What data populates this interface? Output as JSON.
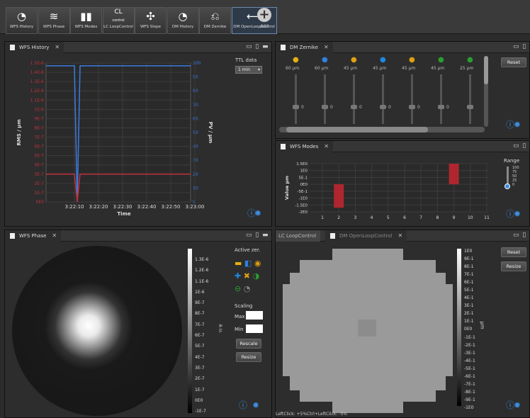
{
  "toolbar": {
    "items": [
      {
        "label": "WFS History",
        "icon": "clock-icon"
      },
      {
        "label": "WFS Phase",
        "icon": "wave-icon"
      },
      {
        "label": "WFS Modes",
        "icon": "bars-icon"
      },
      {
        "label": "LC LoopControl",
        "icon": "cl-icon",
        "title": "CL",
        "sub": "control"
      },
      {
        "label": "WFS Slope",
        "icon": "arrows-icon"
      },
      {
        "label": "DM History",
        "icon": "clock-icon"
      },
      {
        "label": "DM Zernike",
        "icon": "reset-icon"
      },
      {
        "label": "DM OpenLoopControl",
        "icon": "openloop-icon"
      }
    ],
    "add_label": "Add"
  },
  "history": {
    "tab": "WFS History",
    "ttl_label": "TTL data",
    "ttl_value": "1 min",
    "ylabel_left": "RMS / µm",
    "ylabel_right": "PV / µm",
    "xlabel": "Time",
    "left_ticks": [
      "1.5E-6",
      "1.4E-6",
      "1.3E-6",
      "1.2E-6",
      "1.1E-6",
      "1E-6",
      "9E-7",
      "8E-7",
      "7E-7",
      "6E-7",
      "5E-7",
      "4E-7",
      "3E-7",
      "2E-7",
      "1E-7",
      "0E0"
    ],
    "right_ticks": [
      "100",
      "90",
      "80",
      "70",
      "60",
      "50",
      "40",
      "30",
      "20",
      "10",
      "0"
    ],
    "x_ticks": [
      "3:22:10",
      "3:22:20",
      "3:22:30",
      "3:22:40",
      "3:22:50",
      "3:23:00"
    ]
  },
  "chart_data": {
    "type": "line",
    "x": [
      "3:22:05",
      "3:22:08",
      "3:22:09",
      "3:22:10",
      "3:23:05"
    ],
    "xlabel": "Time",
    "ylabel": "RMS / µm",
    "series": [
      {
        "color": "#3b7be0",
        "values": [
          100,
          100,
          0,
          100,
          100
        ]
      },
      {
        "color": "#c0303a",
        "values": [
          3,
          3,
          0,
          3,
          3
        ]
      }
    ]
  },
  "zernike": {
    "tab": "DM Zernike",
    "reset": "Reset",
    "sliders": [
      {
        "label": "60 µm",
        "value": "0"
      },
      {
        "label": "60 µm",
        "value": "0"
      },
      {
        "label": "45 µm",
        "value": "0"
      },
      {
        "label": "45 µm",
        "value": "0"
      },
      {
        "label": "45 µm",
        "value": "0"
      },
      {
        "label": "45 µm",
        "value": "0"
      },
      {
        "label": "25 µm",
        "value": ""
      }
    ]
  },
  "modes": {
    "tab": "WFS Modes",
    "range_label": "Range",
    "ylabel": "Value µm",
    "y_ticks": [
      "1.5E0",
      "1E0",
      "5E-1",
      "0E0",
      "-5E-1",
      "-1E0",
      "-1.5E0",
      "-2E0"
    ],
    "x_ticks": [
      "1",
      "2",
      "3",
      "4",
      "5",
      "6",
      "7",
      "8",
      "9",
      "10",
      "11"
    ],
    "range_ticks": [
      "100",
      "75",
      "50",
      "25",
      "0"
    ]
  },
  "phase": {
    "tab": "WFS Phase",
    "active_label": "Active zer.",
    "scaling_label": "Scaling",
    "max_label": "Max",
    "min_label": "Min",
    "rescale": "Rescale",
    "resize": "Resize",
    "unit": "a.u.",
    "scale": [
      "1.3E-6",
      "1.2E-6",
      "1.1E-6",
      "1E-6",
      "9E-7",
      "8E-7",
      "7E-7",
      "6E-7",
      "5E-7",
      "4E-7",
      "3E-7",
      "2E-7",
      "1E-7",
      "0E0",
      "-1E-7"
    ]
  },
  "loop": {
    "tab1": "LC LoopControl",
    "tab2": "DM OpenLoopControl",
    "reset": "Reset",
    "resize": "Resize",
    "unit": "µm",
    "scale": [
      "1E0",
      "9E-1",
      "8E-1",
      "7E-1",
      "6E-1",
      "5E-1",
      "4E-1",
      "3E-1",
      "2E-1",
      "1E-1",
      "0E0",
      "-1E-1",
      "-2E-1",
      "-3E-1",
      "-4E-1",
      "-5E-1",
      "-6E-1",
      "-7E-1",
      "-8E-1",
      "-9E-1",
      "-1E0"
    ],
    "status": "LeftClick: +5%Ctrl+LeftClick: -5%"
  }
}
